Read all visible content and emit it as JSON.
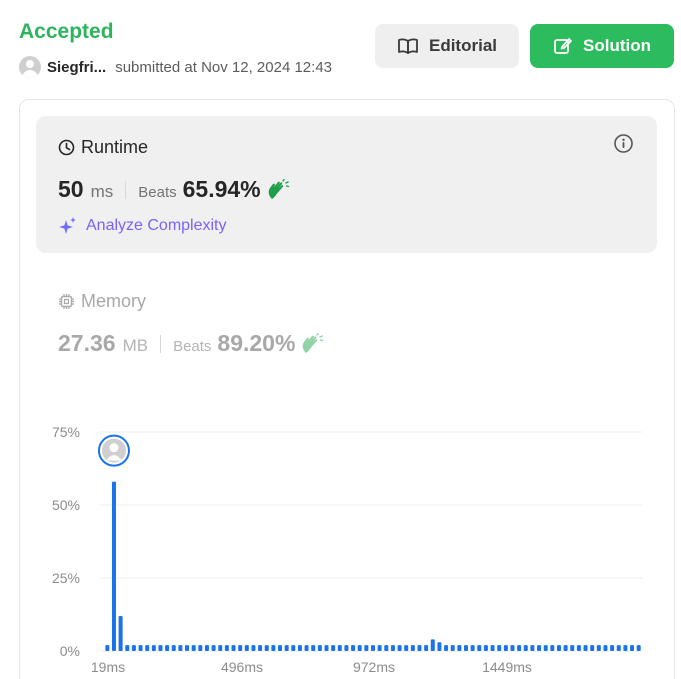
{
  "header": {
    "status": "Accepted",
    "username": "Siegfri...",
    "submitted_text": "submitted at Nov 12, 2024 12:43",
    "editorial_label": "Editorial",
    "solution_label": "Solution"
  },
  "runtime": {
    "label": "Runtime",
    "value": "50",
    "unit": "ms",
    "beats_label": "Beats",
    "beats_pct": "65.94%",
    "analyze_label": "Analyze Complexity"
  },
  "memory": {
    "label": "Memory",
    "value": "27.36",
    "unit": "MB",
    "beats_label": "Beats",
    "beats_pct": "89.20%"
  },
  "colors": {
    "accepted": "#2db55d",
    "solution_button": "#2cbb5d",
    "bar": "#1a73e8",
    "analyze_start": "#a259ff",
    "analyze_end": "#3b82f6"
  },
  "icons": {
    "editorial": "book-icon",
    "solution": "edit-icon",
    "runtime": "clock-icon",
    "memory": "chip-icon",
    "info": "info-icon",
    "analyze": "sparkle-icon",
    "beats": "clap-icon"
  },
  "chart_data": {
    "type": "bar",
    "y_ticks": [
      "75%",
      "50%",
      "25%",
      "0%"
    ],
    "ylim": [
      0,
      75
    ],
    "x_tick_labels": [
      "19ms",
      "496ms",
      "972ms",
      "1449ms"
    ],
    "values": [
      2,
      58,
      12,
      2,
      2,
      2,
      2,
      2,
      2,
      2,
      2,
      2,
      2,
      2,
      2,
      2,
      2,
      2,
      2,
      2,
      2,
      2,
      2,
      2,
      2,
      2,
      2,
      2,
      2,
      2,
      2,
      2,
      2,
      2,
      2,
      2,
      2,
      2,
      2,
      2,
      2,
      2,
      2,
      2,
      2,
      2,
      2,
      2,
      2,
      4,
      3,
      2,
      2,
      2,
      2,
      2,
      2,
      2,
      2,
      2,
      2,
      2,
      2,
      2,
      2,
      2,
      2,
      2,
      2,
      2,
      2,
      2,
      2,
      2,
      2,
      2,
      2,
      2,
      2,
      2,
      2
    ],
    "highlight_index": 1,
    "grid": true
  }
}
